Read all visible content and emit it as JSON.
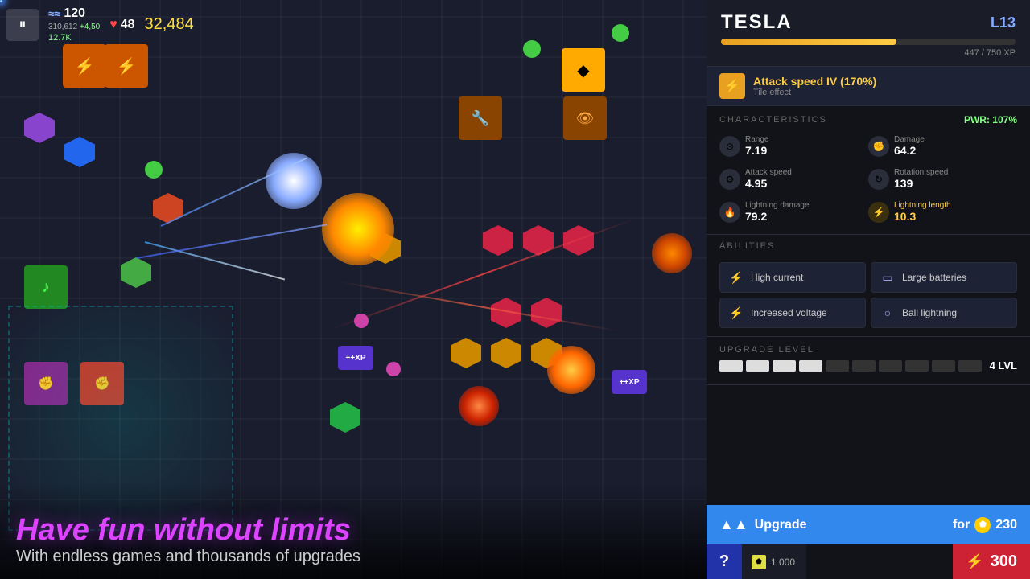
{
  "game": {
    "wave": "120",
    "health": "48",
    "score": "32,484",
    "sub_score": "310,612",
    "sub_score2": "+4,50",
    "dps": "12.7K"
  },
  "bottom_text": {
    "title": "Have fun without limits",
    "subtitle": "With endless games and thousands of upgrades"
  },
  "panel": {
    "tower_name": "TESLA",
    "tower_level": "L13",
    "xp_current": "447",
    "xp_max": "750",
    "xp_label": "447 / 750 XP",
    "xp_percent": 59.6,
    "tile_effect_name": "Attack speed IV (170%)",
    "tile_effect_label": "Tile effect",
    "pwr": "PWR: 107%",
    "characteristics_title": "CHARACTERISTICS",
    "stats": [
      {
        "label": "Range",
        "value": "7.19",
        "icon": "⊙",
        "highlighted": false
      },
      {
        "label": "Damage",
        "value": "64.2",
        "icon": "✊",
        "highlighted": false
      },
      {
        "label": "Attack speed",
        "value": "4.95",
        "icon": "⚡",
        "highlighted": false
      },
      {
        "label": "Rotation speed",
        "value": "139",
        "icon": "↻",
        "highlighted": false
      },
      {
        "label": "Lightning damage",
        "value": "79.2",
        "icon": "🔥",
        "highlighted": false
      },
      {
        "label": "Lightning length",
        "value": "10.3",
        "icon": "⚡",
        "highlighted": true
      }
    ],
    "abilities_title": "ABILITIES",
    "abilities": [
      {
        "label": "High current",
        "icon": "⚡"
      },
      {
        "label": "Large batteries",
        "icon": "▭"
      },
      {
        "label": "Increased voltage",
        "icon": "⚡"
      },
      {
        "label": "Ball lightning",
        "icon": "○"
      }
    ],
    "upgrade_level_title": "UPGRADE LEVEL",
    "upgrade_level_value": "4 LVL",
    "upgrade_blocks_filled": 4,
    "upgrade_blocks_total": 10,
    "upgrade_btn_label": "Upgrade",
    "upgrade_for_label": "for",
    "upgrade_cost": "230",
    "help_label": "?",
    "currency_small_amount": "1 000",
    "currency_main_amount": "300"
  }
}
